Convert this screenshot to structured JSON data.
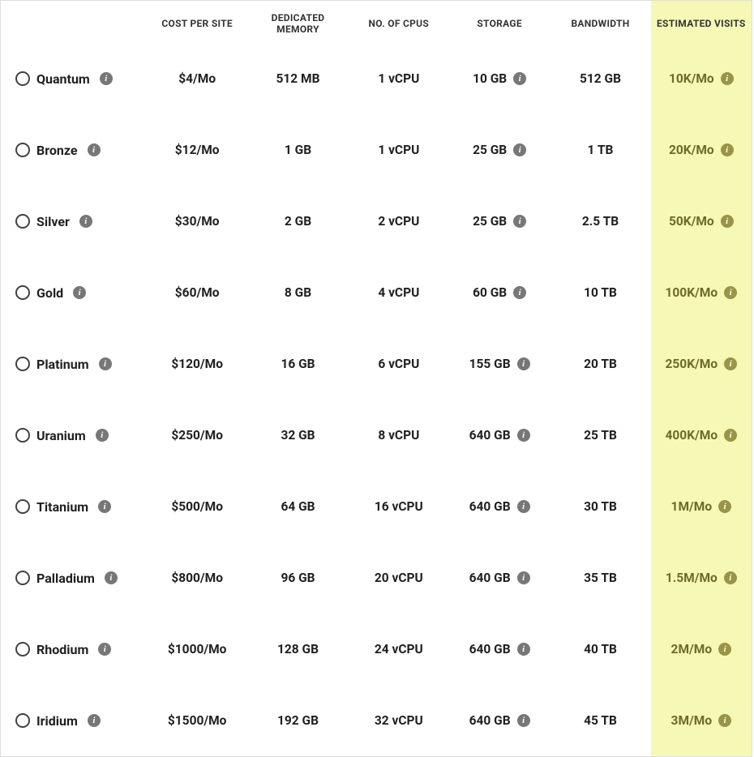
{
  "headers": {
    "plan": "",
    "cost": "COST PER SITE",
    "memory": "DEDICATED MEMORY",
    "cpus": "NO. OF CPUS",
    "storage": "STORAGE",
    "bandwidth": "BANDWIDTH",
    "visits": "ESTIMATED VISITS"
  },
  "info_glyph": "i",
  "plans": [
    {
      "name": "Quantum",
      "cost": "$4/Mo",
      "memory": "512 MB",
      "cpus": "1 vCPU",
      "storage": "10 GB",
      "bandwidth": "512 GB",
      "visits": "10K/Mo"
    },
    {
      "name": "Bronze",
      "cost": "$12/Mo",
      "memory": "1 GB",
      "cpus": "1 vCPU",
      "storage": "25 GB",
      "bandwidth": "1 TB",
      "visits": "20K/Mo"
    },
    {
      "name": "Silver",
      "cost": "$30/Mo",
      "memory": "2 GB",
      "cpus": "2 vCPU",
      "storage": "25 GB",
      "bandwidth": "2.5 TB",
      "visits": "50K/Mo"
    },
    {
      "name": "Gold",
      "cost": "$60/Mo",
      "memory": "8 GB",
      "cpus": "4 vCPU",
      "storage": "60 GB",
      "bandwidth": "10 TB",
      "visits": "100K/Mo"
    },
    {
      "name": "Platinum",
      "cost": "$120/Mo",
      "memory": "16 GB",
      "cpus": "6 vCPU",
      "storage": "155 GB",
      "bandwidth": "20 TB",
      "visits": "250K/Mo"
    },
    {
      "name": "Uranium",
      "cost": "$250/Mo",
      "memory": "32 GB",
      "cpus": "8 vCPU",
      "storage": "640 GB",
      "bandwidth": "25 TB",
      "visits": "400K/Mo"
    },
    {
      "name": "Titanium",
      "cost": "$500/Mo",
      "memory": "64 GB",
      "cpus": "16 vCPU",
      "storage": "640 GB",
      "bandwidth": "30 TB",
      "visits": "1M/Mo"
    },
    {
      "name": "Palladium",
      "cost": "$800/Mo",
      "memory": "96 GB",
      "cpus": "20 vCPU",
      "storage": "640 GB",
      "bandwidth": "35 TB",
      "visits": "1.5M/Mo"
    },
    {
      "name": "Rhodium",
      "cost": "$1000/Mo",
      "memory": "128 GB",
      "cpus": "24 vCPU",
      "storage": "640 GB",
      "bandwidth": "40 TB",
      "visits": "2M/Mo"
    },
    {
      "name": "Iridium",
      "cost": "$1500/Mo",
      "memory": "192 GB",
      "cpus": "32 vCPU",
      "storage": "640 GB",
      "bandwidth": "45 TB",
      "visits": "3M/Mo"
    }
  ]
}
